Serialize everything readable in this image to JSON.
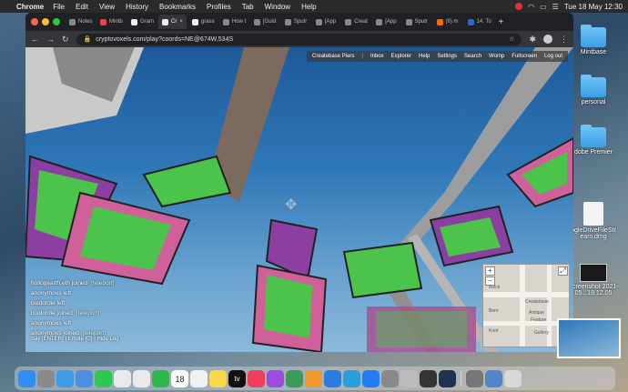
{
  "menubar": {
    "app_name": "Chrome",
    "menus": [
      "File",
      "Edit",
      "View",
      "History",
      "Bookmarks",
      "Profiles",
      "Tab",
      "Window",
      "Help"
    ],
    "clock": "Tue 18 May  12:30"
  },
  "desktop_icons": [
    {
      "label": "Mintbase",
      "kind": "folder"
    },
    {
      "label": "personal",
      "kind": "folder"
    },
    {
      "label": "dobe Premier",
      "kind": "folder"
    },
    {
      "label": "ogleDriveFileStr eam.dmg",
      "kind": "dmg"
    },
    {
      "label": "Screenshot 2021-05...18.12.05",
      "kind": "screenshot"
    }
  ],
  "tabs": [
    {
      "label": "Notes",
      "active": false
    },
    {
      "label": "Mintb",
      "active": false
    },
    {
      "label": "Gram",
      "active": false
    },
    {
      "label": "Cr",
      "active": true
    },
    {
      "label": "grass",
      "active": false
    },
    {
      "label": "How t",
      "active": false
    },
    {
      "label": "[Guid",
      "active": false
    },
    {
      "label": "Sputr",
      "active": false
    },
    {
      "label": "[App",
      "active": false
    },
    {
      "label": "Creat",
      "active": false
    },
    {
      "label": "[App",
      "active": false
    },
    {
      "label": "Sputr",
      "active": false
    },
    {
      "label": "(6) m",
      "active": false
    },
    {
      "label": "14. To",
      "active": false
    }
  ],
  "address_bar": {
    "url": "cryptovoxels.com/play?coords=NE@674W,534S"
  },
  "game_nav": [
    "Createbase Piers",
    "Inbox",
    "Explorer",
    "Help",
    "Settings",
    "Search",
    "Womp",
    "Fullscreen",
    "Log out"
  ],
  "chat": {
    "lines": [
      {
        "text": "hollogearth.eth joined",
        "link": "[teleport]"
      },
      {
        "text": "anonymous left",
        "link": ""
      },
      {
        "text": "buidordie left",
        "link": ""
      },
      {
        "text": "buidordie joined",
        "link": "[teleport]"
      },
      {
        "text": "anonymous left",
        "link": ""
      },
      {
        "text": "anonymous joined",
        "link": "[teleport]"
      }
    ],
    "footer": "Say [ENTER] | Emote [G] | Hide Log"
  },
  "minimap": {
    "zoom_in": "+",
    "zoom_out": "−",
    "labels": [
      "Block",
      "Createbase",
      "Bern",
      "Knot",
      "Antique",
      "Feature",
      "Gallery"
    ]
  },
  "dock": {
    "calendar_day": "18",
    "tv_label": "tv"
  },
  "colors": {
    "menubar": "#2b2b2b",
    "chrome_dark": "#202124",
    "sky": "#2f78b8",
    "tile_green": "#4cc34a",
    "tile_purple": "#8b3fa0",
    "tile_pink": "#d0609a"
  }
}
